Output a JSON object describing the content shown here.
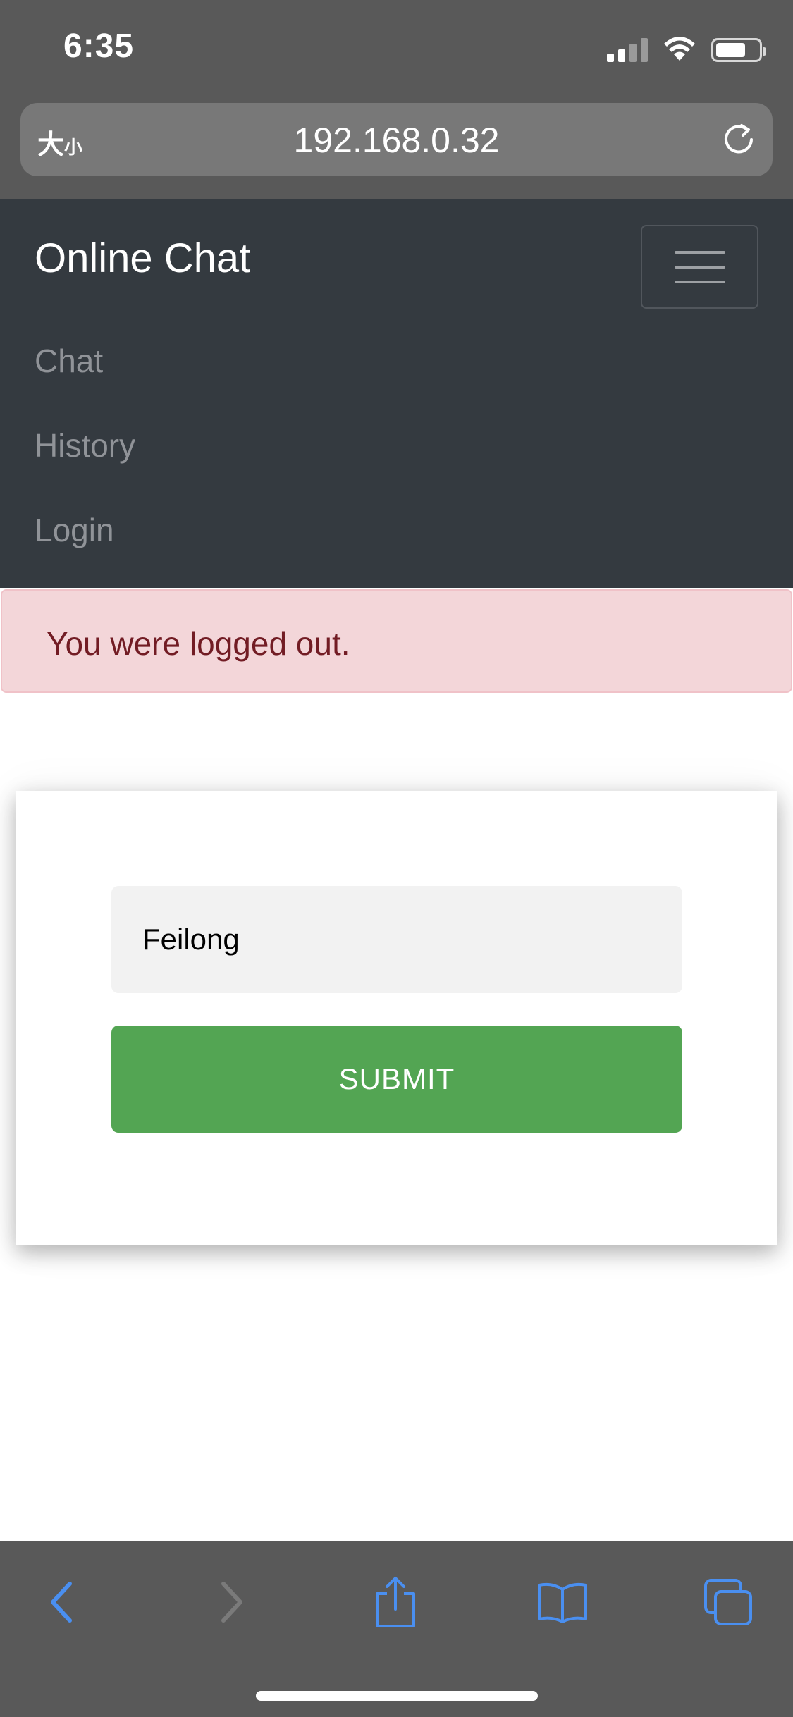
{
  "status_bar": {
    "time": "6:35"
  },
  "browser": {
    "text_size_label_big": "大",
    "text_size_label_small": "小",
    "url": "192.168.0.32"
  },
  "navbar": {
    "brand": "Online Chat",
    "links": [
      {
        "label": "Chat"
      },
      {
        "label": "History"
      },
      {
        "label": "Login"
      }
    ]
  },
  "alert": {
    "message": "You were logged out."
  },
  "login_form": {
    "name_value": "Feilong",
    "submit_label": "SUBMIT"
  },
  "colors": {
    "navbar_bg": "#343a40",
    "alert_bg": "#f3d6d9",
    "alert_text": "#721c24",
    "submit_bg": "#53a553",
    "toolbar_icon_active": "#4a8ff0",
    "toolbar_icon_disabled": "#7a7a7a"
  },
  "toolbar": {
    "icons": [
      "back-icon",
      "forward-icon",
      "share-icon",
      "bookmarks-icon",
      "tabs-icon"
    ]
  }
}
